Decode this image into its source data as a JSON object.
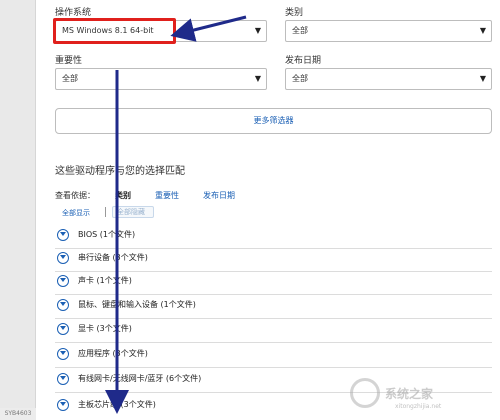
{
  "filters": {
    "os_label": "操作系统",
    "os_value": "MS Windows 8.1 64-bit",
    "category_label": "类别",
    "category_value": "全部",
    "importance_label": "重要性",
    "importance_value": "全部",
    "release_label": "发布日期",
    "release_value": "全部",
    "more_filters": "更多筛选器"
  },
  "results": {
    "heading": "这些驱动程序与您的选择匹配",
    "view_by_label": "查看依据：",
    "tabs": [
      "类别",
      "重要性",
      "发布日期"
    ],
    "show_all": "全部显示",
    "hide_all": "全部隐藏",
    "categories": [
      "BIOS (1个文件)",
      "串行设备 (3个文件)",
      "声卡 (1个文件)",
      "鼠标、键盘和输入设备 (1个文件)",
      "显卡 (3个文件)",
      "应用程序 (3个文件)",
      "有线网卡/无线网卡/蓝牙 (6个文件)",
      "主板芯片组 (3个文件)"
    ]
  },
  "footer_tag": "SYB4603",
  "watermark": {
    "brand": "系统之家",
    "url": "xitongzhijia.net"
  },
  "colors": {
    "accent": "#1a5fb4",
    "highlight": "#e0201c",
    "arrow": "#1f2a8a"
  }
}
